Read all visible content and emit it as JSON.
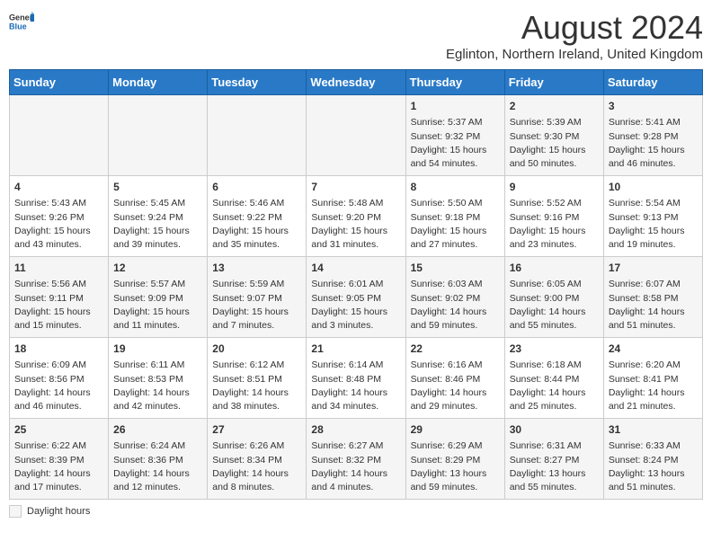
{
  "header": {
    "logo_general": "General",
    "logo_blue": "Blue",
    "month_title": "August 2024",
    "subtitle": "Eglinton, Northern Ireland, United Kingdom"
  },
  "footer": {
    "daylight_label": "Daylight hours"
  },
  "days_of_week": [
    "Sunday",
    "Monday",
    "Tuesday",
    "Wednesday",
    "Thursday",
    "Friday",
    "Saturday"
  ],
  "weeks": [
    [
      {
        "day": "",
        "sunrise": "",
        "sunset": "",
        "daylight": ""
      },
      {
        "day": "",
        "sunrise": "",
        "sunset": "",
        "daylight": ""
      },
      {
        "day": "",
        "sunrise": "",
        "sunset": "",
        "daylight": ""
      },
      {
        "day": "",
        "sunrise": "",
        "sunset": "",
        "daylight": ""
      },
      {
        "day": "1",
        "sunrise": "5:37 AM",
        "sunset": "9:32 PM",
        "daylight": "15 hours and 54 minutes."
      },
      {
        "day": "2",
        "sunrise": "5:39 AM",
        "sunset": "9:30 PM",
        "daylight": "15 hours and 50 minutes."
      },
      {
        "day": "3",
        "sunrise": "5:41 AM",
        "sunset": "9:28 PM",
        "daylight": "15 hours and 46 minutes."
      }
    ],
    [
      {
        "day": "4",
        "sunrise": "5:43 AM",
        "sunset": "9:26 PM",
        "daylight": "15 hours and 43 minutes."
      },
      {
        "day": "5",
        "sunrise": "5:45 AM",
        "sunset": "9:24 PM",
        "daylight": "15 hours and 39 minutes."
      },
      {
        "day": "6",
        "sunrise": "5:46 AM",
        "sunset": "9:22 PM",
        "daylight": "15 hours and 35 minutes."
      },
      {
        "day": "7",
        "sunrise": "5:48 AM",
        "sunset": "9:20 PM",
        "daylight": "15 hours and 31 minutes."
      },
      {
        "day": "8",
        "sunrise": "5:50 AM",
        "sunset": "9:18 PM",
        "daylight": "15 hours and 27 minutes."
      },
      {
        "day": "9",
        "sunrise": "5:52 AM",
        "sunset": "9:16 PM",
        "daylight": "15 hours and 23 minutes."
      },
      {
        "day": "10",
        "sunrise": "5:54 AM",
        "sunset": "9:13 PM",
        "daylight": "15 hours and 19 minutes."
      }
    ],
    [
      {
        "day": "11",
        "sunrise": "5:56 AM",
        "sunset": "9:11 PM",
        "daylight": "15 hours and 15 minutes."
      },
      {
        "day": "12",
        "sunrise": "5:57 AM",
        "sunset": "9:09 PM",
        "daylight": "15 hours and 11 minutes."
      },
      {
        "day": "13",
        "sunrise": "5:59 AM",
        "sunset": "9:07 PM",
        "daylight": "15 hours and 7 minutes."
      },
      {
        "day": "14",
        "sunrise": "6:01 AM",
        "sunset": "9:05 PM",
        "daylight": "15 hours and 3 minutes."
      },
      {
        "day": "15",
        "sunrise": "6:03 AM",
        "sunset": "9:02 PM",
        "daylight": "14 hours and 59 minutes."
      },
      {
        "day": "16",
        "sunrise": "6:05 AM",
        "sunset": "9:00 PM",
        "daylight": "14 hours and 55 minutes."
      },
      {
        "day": "17",
        "sunrise": "6:07 AM",
        "sunset": "8:58 PM",
        "daylight": "14 hours and 51 minutes."
      }
    ],
    [
      {
        "day": "18",
        "sunrise": "6:09 AM",
        "sunset": "8:56 PM",
        "daylight": "14 hours and 46 minutes."
      },
      {
        "day": "19",
        "sunrise": "6:11 AM",
        "sunset": "8:53 PM",
        "daylight": "14 hours and 42 minutes."
      },
      {
        "day": "20",
        "sunrise": "6:12 AM",
        "sunset": "8:51 PM",
        "daylight": "14 hours and 38 minutes."
      },
      {
        "day": "21",
        "sunrise": "6:14 AM",
        "sunset": "8:48 PM",
        "daylight": "14 hours and 34 minutes."
      },
      {
        "day": "22",
        "sunrise": "6:16 AM",
        "sunset": "8:46 PM",
        "daylight": "14 hours and 29 minutes."
      },
      {
        "day": "23",
        "sunrise": "6:18 AM",
        "sunset": "8:44 PM",
        "daylight": "14 hours and 25 minutes."
      },
      {
        "day": "24",
        "sunrise": "6:20 AM",
        "sunset": "8:41 PM",
        "daylight": "14 hours and 21 minutes."
      }
    ],
    [
      {
        "day": "25",
        "sunrise": "6:22 AM",
        "sunset": "8:39 PM",
        "daylight": "14 hours and 17 minutes."
      },
      {
        "day": "26",
        "sunrise": "6:24 AM",
        "sunset": "8:36 PM",
        "daylight": "14 hours and 12 minutes."
      },
      {
        "day": "27",
        "sunrise": "6:26 AM",
        "sunset": "8:34 PM",
        "daylight": "14 hours and 8 minutes."
      },
      {
        "day": "28",
        "sunrise": "6:27 AM",
        "sunset": "8:32 PM",
        "daylight": "14 hours and 4 minutes."
      },
      {
        "day": "29",
        "sunrise": "6:29 AM",
        "sunset": "8:29 PM",
        "daylight": "13 hours and 59 minutes."
      },
      {
        "day": "30",
        "sunrise": "6:31 AM",
        "sunset": "8:27 PM",
        "daylight": "13 hours and 55 minutes."
      },
      {
        "day": "31",
        "sunrise": "6:33 AM",
        "sunset": "8:24 PM",
        "daylight": "13 hours and 51 minutes."
      }
    ]
  ]
}
